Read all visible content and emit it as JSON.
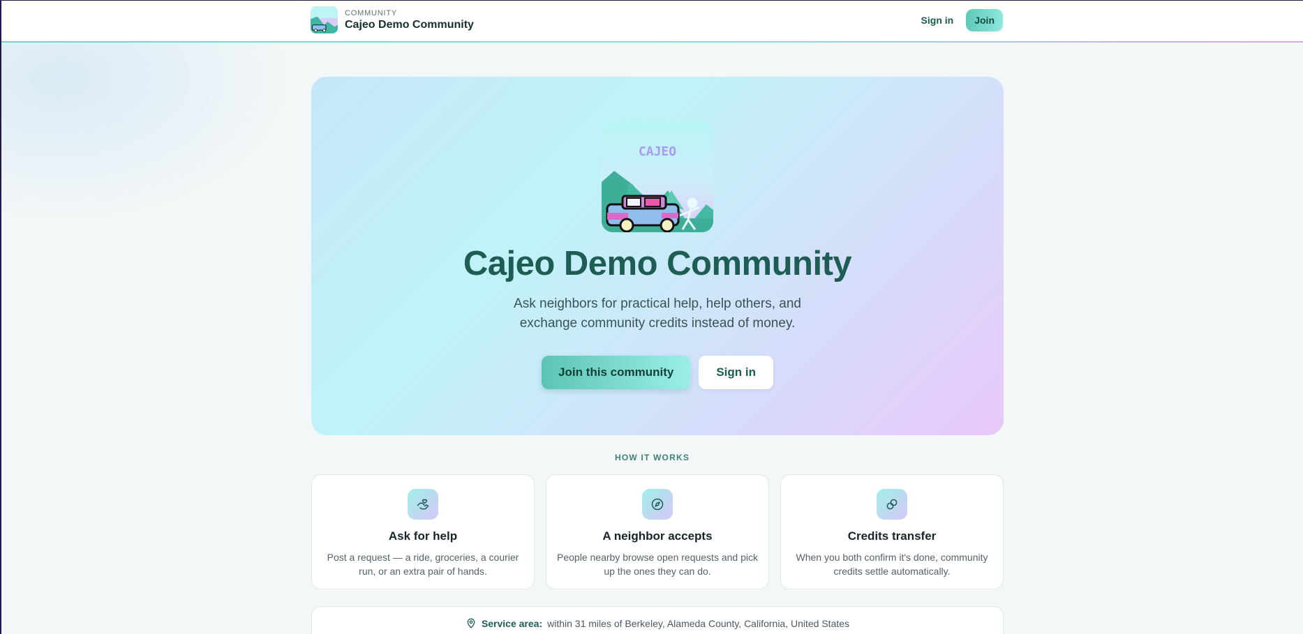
{
  "header": {
    "kicker": "COMMUNITY",
    "title": "Cajeo Demo Community",
    "signin_label": "Sign in",
    "join_label": "Join"
  },
  "hero": {
    "logo_text": "CAJEO",
    "title": "Cajeo Demo Community",
    "subtitle_line1": "Ask neighbors for practical help, help others, and",
    "subtitle_line2": "exchange community credits instead of money.",
    "primary_button": "Join this community",
    "secondary_button": "Sign in"
  },
  "how_it_works": {
    "label": "HOW IT WORKS",
    "cards": [
      {
        "icon": "hand-heart-icon",
        "title": "Ask for help",
        "desc": "Post a request — a ride, groceries, a courier run, or an extra pair of hands."
      },
      {
        "icon": "compass-icon",
        "title": "A neighbor accepts",
        "desc": "People nearby browse open requests and pick up the ones they can do."
      },
      {
        "icon": "link-icon",
        "title": "Credits transfer",
        "desc": "When you both confirm it's done, community credits settle automatically."
      }
    ]
  },
  "service_area": {
    "label": "Service area:",
    "value": "within 31 miles of Berkeley, Alameda County, California, United States"
  },
  "colors": {
    "accent": "#1d5d54",
    "button_gradient_start": "#5cc4b3",
    "button_gradient_end": "#9beee6"
  }
}
